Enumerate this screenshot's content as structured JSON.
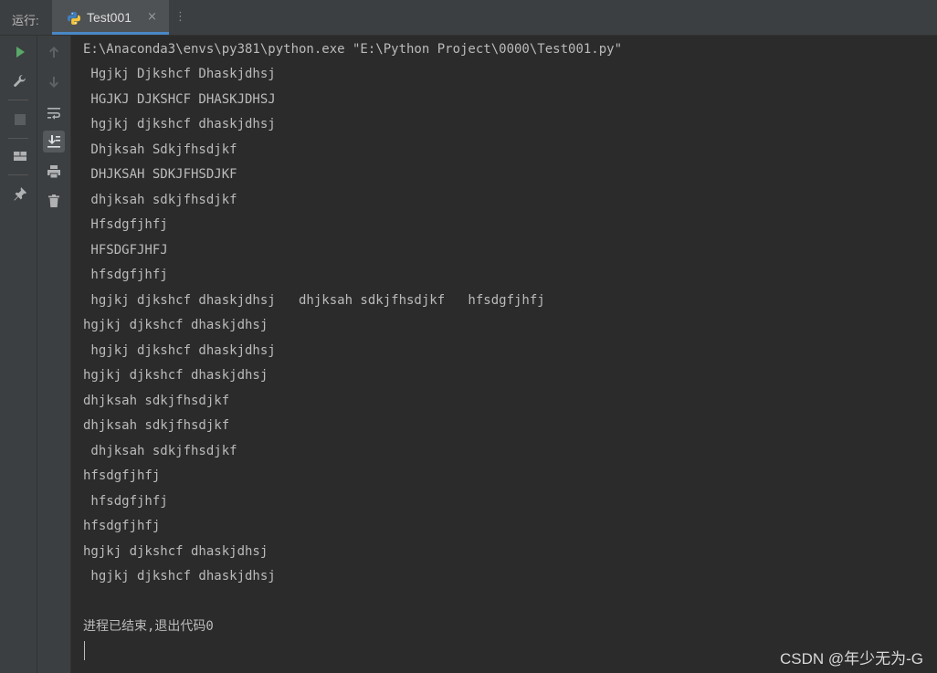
{
  "tabbar": {
    "run_label": "运行:",
    "tab_title": "Test001",
    "close_glyph": "×"
  },
  "console": {
    "lines": [
      "E:\\Anaconda3\\envs\\py381\\python.exe \"E:\\Python Project\\0000\\Test001.py\"",
      " Hgjkj Djkshcf Dhaskjdhsj",
      " HGJKJ DJKSHCF DHASKJDHSJ",
      " hgjkj djkshcf dhaskjdhsj",
      " Dhjksah Sdkjfhsdjkf",
      " DHJKSAH SDKJFHSDJKF",
      " dhjksah sdkjfhsdjkf",
      " Hfsdgfjhfj",
      " HFSDGFJHFJ",
      " hfsdgfjhfj",
      " hgjkj djkshcf dhaskjdhsj   dhjksah sdkjfhsdjkf   hfsdgfjhfj",
      "hgjkj djkshcf dhaskjdhsj",
      " hgjkj djkshcf dhaskjdhsj",
      "hgjkj djkshcf dhaskjdhsj",
      "dhjksah sdkjfhsdjkf",
      "dhjksah sdkjfhsdjkf",
      " dhjksah sdkjfhsdjkf",
      "hfsdgfjhfj",
      " hfsdgfjhfj",
      "hfsdgfjhfj",
      "hgjkj djkshcf dhaskjdhsj",
      " hgjkj djkshcf dhaskjdhsj",
      "",
      "进程已结束,退出代码0"
    ]
  },
  "watermark": "CSDN @年少无为-G",
  "toolbar": {
    "left": [
      "run-icon",
      "wrench-icon",
      "stop-icon",
      "layout-icon",
      "pin-icon"
    ],
    "right": [
      "arrow-up-icon",
      "arrow-down-icon",
      "soft-wrap-icon",
      "scroll-to-end-icon",
      "print-icon",
      "trash-icon"
    ]
  },
  "colors": {
    "background": "#2b2b2b",
    "panel": "#3c3f41",
    "text": "#bbbbbb",
    "run_green": "#59a869",
    "accent": "#4a88c7"
  }
}
